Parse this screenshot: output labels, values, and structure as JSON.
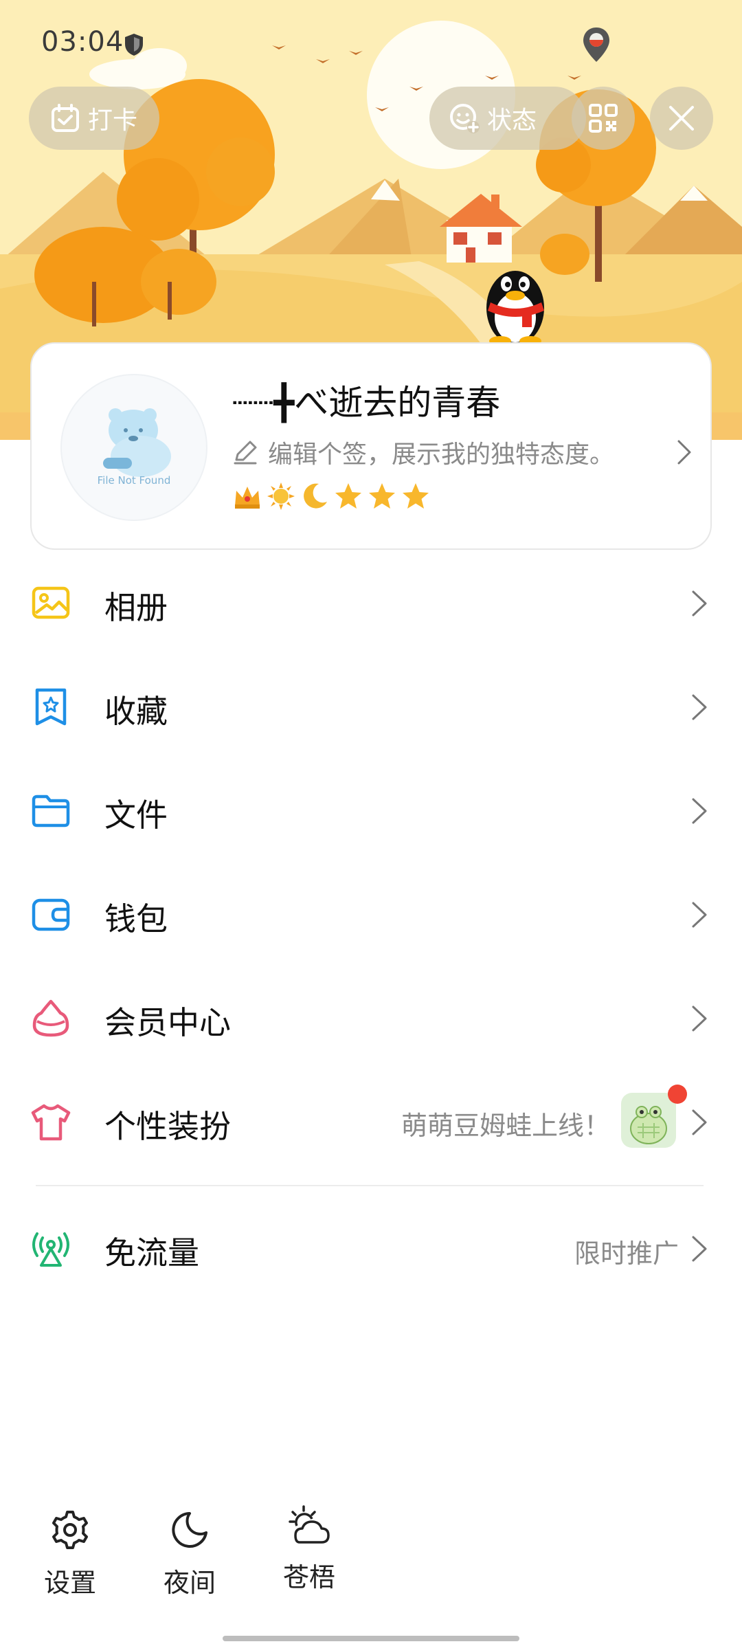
{
  "status_bar": {
    "time": "03:04",
    "icons": [
      "shield-icon",
      "location-icon"
    ]
  },
  "header": {
    "checkin_label": "打卡",
    "status_label": "状态",
    "qr_icon": "qr-code-icon",
    "close_icon": "close-icon"
  },
  "profile": {
    "nickname": "┈┈╋べ逝去的青春",
    "avatar_text": "File Not Found",
    "signature_placeholder": "编辑个签，展示我的独特态度。",
    "badges": [
      "crown-icon",
      "sun-icon",
      "moon-icon",
      "star-icon",
      "star-icon",
      "star-icon"
    ]
  },
  "menu": [
    {
      "label": "相册",
      "icon": "photo-album-icon",
      "color": "#F5C518"
    },
    {
      "label": "收藏",
      "icon": "favorites-icon",
      "color": "#1E8FE6"
    },
    {
      "label": "文件",
      "icon": "folder-icon",
      "color": "#1E8FE6"
    },
    {
      "label": "钱包",
      "icon": "wallet-icon",
      "color": "#1E8FE6"
    },
    {
      "label": "会员中心",
      "icon": "vip-icon",
      "color": "#E85A7A"
    },
    {
      "label": "个性装扮",
      "icon": "tshirt-icon",
      "color": "#E85A7A",
      "extra": "萌萌豆姆蛙上线！"
    },
    {
      "label": "免流量",
      "icon": "free-data-icon",
      "color": "#22B573",
      "extra": "限时推广"
    }
  ],
  "bottom_bar": [
    {
      "label": "设置",
      "icon": "gear-icon"
    },
    {
      "label": "夜间",
      "icon": "moon-icon"
    },
    {
      "label": "苍梧",
      "icon": "weather-icon"
    }
  ]
}
